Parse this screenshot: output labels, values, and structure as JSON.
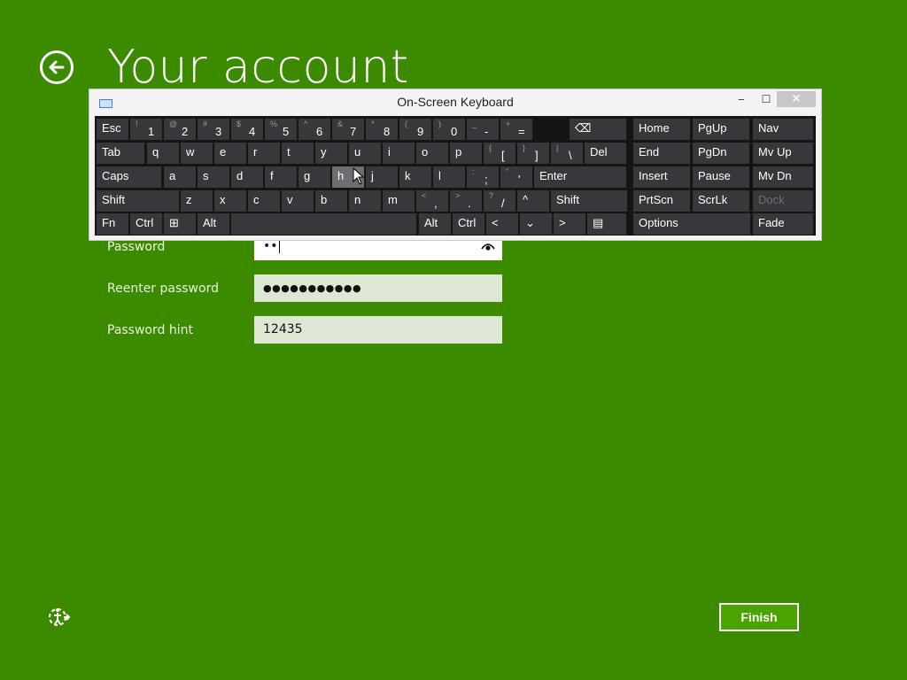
{
  "page": {
    "title": "Your account",
    "finish_label": "Finish"
  },
  "form": {
    "password_label": "Password",
    "password_value": "••",
    "reenter_label": "Reenter password",
    "reenter_value": "●●●●●●●●●●●",
    "hint_label": "Password hint",
    "hint_value": "12435"
  },
  "icons": {
    "back": "back-arrow-icon",
    "eye": "reveal-password-icon",
    "ease_of_access": "ease-of-access-icon",
    "keyboard_app": "keyboard-icon"
  },
  "osk": {
    "title": "On-Screen Keyboard",
    "window_buttons": {
      "minimize": "‒",
      "maximize": "☐",
      "close": "✕"
    },
    "rows": [
      [
        {
          "id": "esc",
          "label": "Esc"
        },
        {
          "id": "1",
          "primary": "1",
          "secondary": "!"
        },
        {
          "id": "2",
          "primary": "2",
          "secondary": "@"
        },
        {
          "id": "3",
          "primary": "3",
          "secondary": "#"
        },
        {
          "id": "4",
          "primary": "4",
          "secondary": "$"
        },
        {
          "id": "5",
          "primary": "5",
          "secondary": "%"
        },
        {
          "id": "6",
          "primary": "6",
          "secondary": "^"
        },
        {
          "id": "7",
          "primary": "7",
          "secondary": "&"
        },
        {
          "id": "8",
          "primary": "8",
          "secondary": "*"
        },
        {
          "id": "9",
          "primary": "9",
          "secondary": "("
        },
        {
          "id": "0",
          "primary": "0",
          "secondary": ")"
        },
        {
          "id": "minus",
          "primary": "-",
          "secondary": "_"
        },
        {
          "id": "equals",
          "primary": "=",
          "secondary": "+"
        },
        {
          "id": "backspace",
          "label": "⌫"
        },
        {
          "id": "home",
          "label": "Home"
        },
        {
          "id": "pgup",
          "label": "PgUp"
        },
        {
          "id": "nav",
          "label": "Nav"
        }
      ],
      [
        {
          "id": "tab",
          "label": "Tab"
        },
        {
          "id": "q",
          "label": "q"
        },
        {
          "id": "w",
          "label": "w"
        },
        {
          "id": "e",
          "label": "e"
        },
        {
          "id": "r",
          "label": "r"
        },
        {
          "id": "t",
          "label": "t"
        },
        {
          "id": "y",
          "label": "y"
        },
        {
          "id": "u",
          "label": "u"
        },
        {
          "id": "i",
          "label": "i"
        },
        {
          "id": "o",
          "label": "o"
        },
        {
          "id": "p",
          "label": "p"
        },
        {
          "id": "lbracket",
          "primary": "[",
          "secondary": "{"
        },
        {
          "id": "rbracket",
          "primary": "]",
          "secondary": "}"
        },
        {
          "id": "backslash",
          "primary": "\\",
          "secondary": "|"
        },
        {
          "id": "del",
          "label": "Del"
        },
        {
          "id": "end",
          "label": "End"
        },
        {
          "id": "pgdn",
          "label": "PgDn"
        },
        {
          "id": "mvup",
          "label": "Mv Up"
        }
      ],
      [
        {
          "id": "caps",
          "label": "Caps"
        },
        {
          "id": "a",
          "label": "a"
        },
        {
          "id": "s",
          "label": "s"
        },
        {
          "id": "d",
          "label": "d"
        },
        {
          "id": "f",
          "label": "f"
        },
        {
          "id": "g",
          "label": "g"
        },
        {
          "id": "h",
          "label": "h"
        },
        {
          "id": "j",
          "label": "j"
        },
        {
          "id": "k",
          "label": "k"
        },
        {
          "id": "l",
          "label": "l"
        },
        {
          "id": "semicolon",
          "primary": ";",
          "secondary": ":"
        },
        {
          "id": "quote",
          "primary": "'",
          "secondary": "\""
        },
        {
          "id": "enter",
          "label": "Enter"
        },
        {
          "id": "insert",
          "label": "Insert"
        },
        {
          "id": "pause",
          "label": "Pause"
        },
        {
          "id": "mvdn",
          "label": "Mv Dn"
        }
      ],
      [
        {
          "id": "lshift",
          "label": "Shift"
        },
        {
          "id": "z",
          "label": "z"
        },
        {
          "id": "x",
          "label": "x"
        },
        {
          "id": "c",
          "label": "c"
        },
        {
          "id": "v",
          "label": "v"
        },
        {
          "id": "b",
          "label": "b"
        },
        {
          "id": "n",
          "label": "n"
        },
        {
          "id": "m",
          "label": "m"
        },
        {
          "id": "comma",
          "primary": ",",
          "secondary": "<"
        },
        {
          "id": "period",
          "primary": ".",
          "secondary": ">"
        },
        {
          "id": "slash",
          "primary": "/",
          "secondary": "?"
        },
        {
          "id": "up",
          "label": "^"
        },
        {
          "id": "rshift",
          "label": "Shift"
        },
        {
          "id": "prtscn",
          "label": "PrtScn"
        },
        {
          "id": "scrlk",
          "label": "ScrLk"
        },
        {
          "id": "dock",
          "label": "Dock"
        }
      ],
      [
        {
          "id": "fn",
          "label": "Fn"
        },
        {
          "id": "lctrl",
          "label": "Ctrl"
        },
        {
          "id": "win",
          "label": "⊞"
        },
        {
          "id": "lalt",
          "label": "Alt"
        },
        {
          "id": "space",
          "label": ""
        },
        {
          "id": "ralt",
          "label": "Alt"
        },
        {
          "id": "rctrl",
          "label": "Ctrl"
        },
        {
          "id": "left",
          "label": "<"
        },
        {
          "id": "down",
          "label": "⌄"
        },
        {
          "id": "right",
          "label": ">"
        },
        {
          "id": "menu",
          "label": "▤"
        },
        {
          "id": "options",
          "label": "Options"
        },
        {
          "id": "fade",
          "label": "Fade"
        }
      ]
    ]
  }
}
